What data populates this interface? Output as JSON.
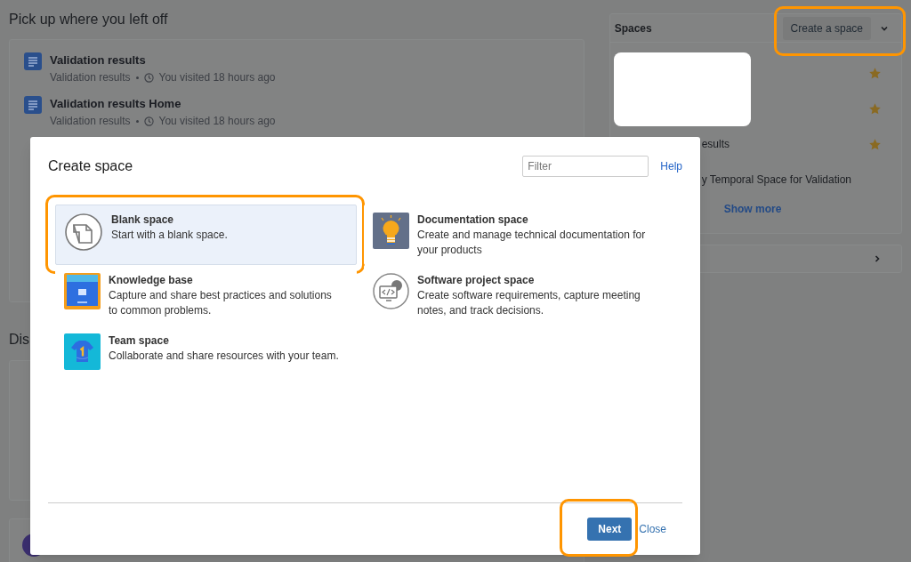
{
  "recent": {
    "heading": "Pick up where you left off",
    "items": [
      {
        "title": "Validation results",
        "space": "Validation results",
        "visited": "You visited 18 hours ago"
      },
      {
        "title": "Validation results Home",
        "space": "Validation results",
        "visited": "You visited 18 hours ago"
      }
    ]
  },
  "discover": {
    "heading": "Dis"
  },
  "spaces": {
    "title": "Spaces",
    "create_button": "Create a space",
    "create_highlighted": true,
    "items": [
      {
        "starred": true
      },
      {
        "starred": true
      },
      {
        "name": "esults",
        "starred": true
      },
      {
        "name": "y Temporal Space for Validation",
        "starred": false
      }
    ],
    "show_more": "Show more"
  },
  "modal": {
    "title": "Create space",
    "filter_placeholder": "Filter",
    "help": "Help",
    "options": [
      {
        "kind": "blank",
        "title": "Blank space",
        "description": "Start with a blank space.",
        "selected": true,
        "highlighted": true
      },
      {
        "kind": "documentation",
        "title": "Documentation space",
        "description": "Create and manage technical documentation for your products",
        "selected": false,
        "highlighted": false
      },
      {
        "kind": "knowledge",
        "title": "Knowledge base",
        "description": "Capture and share best practices and solutions to common problems.",
        "selected": false,
        "highlighted": false
      },
      {
        "kind": "software",
        "title": "Software project space",
        "description": "Create software requirements, capture meeting notes, and track decisions.",
        "selected": false,
        "highlighted": false
      },
      {
        "kind": "team",
        "title": "Team space",
        "description": "Collaborate and share resources with your team.",
        "selected": false,
        "highlighted": false
      }
    ],
    "next": "Next",
    "next_highlighted": true,
    "close": "Close"
  }
}
